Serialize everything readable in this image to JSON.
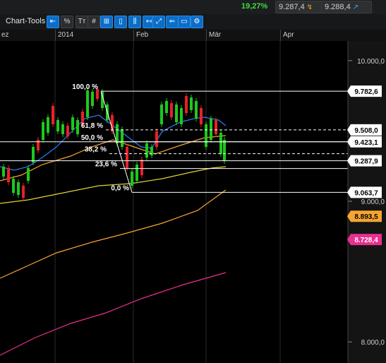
{
  "header": {
    "change_pct": "19,27%",
    "bid": "9.287,4",
    "ask": "9.288,4"
  },
  "toolbar": {
    "label": "Chart-Tools",
    "buttons": [
      {
        "name": "chart-undo-button",
        "glyph": "⇤"
      },
      {
        "name": "percent-button",
        "glyph": "%"
      },
      {
        "name": "text-tool-button",
        "glyph": "Tт"
      },
      {
        "name": "grid-button",
        "glyph": "#"
      },
      {
        "name": "crosshair-button",
        "glyph": "⊞"
      },
      {
        "name": "candlestick-button",
        "glyph": "▯"
      },
      {
        "name": "bar-chart-button",
        "glyph": "⫼"
      },
      {
        "name": "arrow-tool-button",
        "glyph": "↤"
      },
      {
        "name": "line-tool-button",
        "glyph": "⤢"
      },
      {
        "name": "label-tool-button",
        "glyph": "⇐"
      },
      {
        "name": "delete-tool-button",
        "glyph": "▭"
      },
      {
        "name": "settings-button",
        "glyph": "⚙"
      }
    ]
  },
  "xaxis": {
    "labels": [
      "ez",
      "2014",
      "Feb",
      "Mär",
      "Apr"
    ]
  },
  "chart_data": {
    "type": "candlestick",
    "y_ticks": [
      "10.000,0",
      "9.000,0",
      "8.000,0"
    ],
    "price_labels": [
      {
        "value": "9.782,6",
        "color": "#ffffff",
        "text": "#000000"
      },
      {
        "value": "9.508,0",
        "color": "#ffffff",
        "text": "#000000"
      },
      {
        "value": "9.423,1",
        "color": "#ffffff",
        "text": "#000000"
      },
      {
        "value": "9.287,9",
        "color": "#ffffff",
        "text": "#000000"
      },
      {
        "value": "9.063,7",
        "color": "#ffffff",
        "text": "#000000"
      },
      {
        "value": "8.893,5",
        "color": "#f7a530",
        "text": "#000000"
      },
      {
        "value": "8.728,4",
        "color": "#e8308f",
        "text": "#ffffff"
      }
    ],
    "fib_levels": [
      {
        "label": "100,0 %",
        "value": 9782.6
      },
      {
        "label": "61,8 %",
        "value": 9508.0
      },
      {
        "label": "50,0 %",
        "value": 9423.1
      },
      {
        "label": "38,2 %",
        "value": 9338.2
      },
      {
        "label": "23,6 %",
        "value": 9233.0
      },
      {
        "label": "0,0 %",
        "value": 9063.7
      }
    ],
    "ylim": [
      7850,
      10140
    ],
    "colors": {
      "up": "#1ec81e",
      "down": "#e8202a",
      "ma_blue": "#2a7fff",
      "ma_orange": "#f7a530",
      "ma_yellow": "#e6d232",
      "ma_pink": "#e8308f"
    }
  }
}
